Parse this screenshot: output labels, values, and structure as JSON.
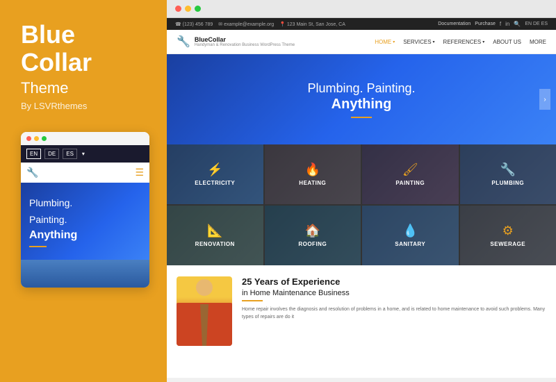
{
  "left": {
    "title_line1": "Blue",
    "title_line2": "Collar",
    "subtitle": "Theme",
    "by": "By LSVRthemes",
    "mobile": {
      "dots": [
        "red",
        "yellow",
        "green"
      ],
      "langs": [
        "EN",
        "DE",
        "ES"
      ],
      "logo_icon": "🔧",
      "hero_text1": "Plumbing.",
      "hero_text2": "Painting.",
      "hero_bold": "Anything"
    }
  },
  "right": {
    "browser_dots": [
      "red",
      "yellow",
      "green"
    ],
    "topbar": {
      "phone": "☎ (123) 456 789",
      "email": "✉ example@example.org",
      "address": "📍 123 Main St, San Jose, CA",
      "doc": "Documentation",
      "purchase": "Purchase",
      "langs": "EN DE ES"
    },
    "header": {
      "logo_name": "BlueCollar",
      "logo_tagline": "Handyman & Renovation Business WordPress Theme",
      "nav": [
        {
          "label": "HOME",
          "active": true,
          "has_arrow": true
        },
        {
          "label": "SERVICES",
          "active": false,
          "has_arrow": true
        },
        {
          "label": "REFERENCES",
          "active": false,
          "has_arrow": true
        },
        {
          "label": "ABOUT US",
          "active": false,
          "has_arrow": false
        },
        {
          "label": "MORE",
          "active": false,
          "has_arrow": false
        }
      ]
    },
    "hero": {
      "line1": "Plumbing. Painting.",
      "line2": "Anything",
      "arrow": "›"
    },
    "services": [
      {
        "label": "Electricity",
        "icon": "⚡",
        "bg": "electricity"
      },
      {
        "label": "Heating",
        "icon": "🔥",
        "bg": "heating"
      },
      {
        "label": "Painting",
        "icon": "🖌",
        "bg": "painting"
      },
      {
        "label": "Plumbing",
        "icon": "🔧",
        "bg": "plumbing"
      },
      {
        "label": "Renovation",
        "icon": "📐",
        "bg": "renovation"
      },
      {
        "label": "Roofing",
        "icon": "🏠",
        "bg": "roofing"
      },
      {
        "label": "Sanitary",
        "icon": "💧",
        "bg": "sanitary"
      },
      {
        "label": "Sewerage",
        "icon": "⚙",
        "bg": "sewerage"
      }
    ],
    "experience": {
      "title": "25 Years of Experience",
      "subtitle": "in Home Maintenance Business",
      "desc": "Home repair involves the diagnosis and resolution of problems in a home, and is related to home maintenance to avoid such problems. Many types of repairs are do it"
    }
  }
}
